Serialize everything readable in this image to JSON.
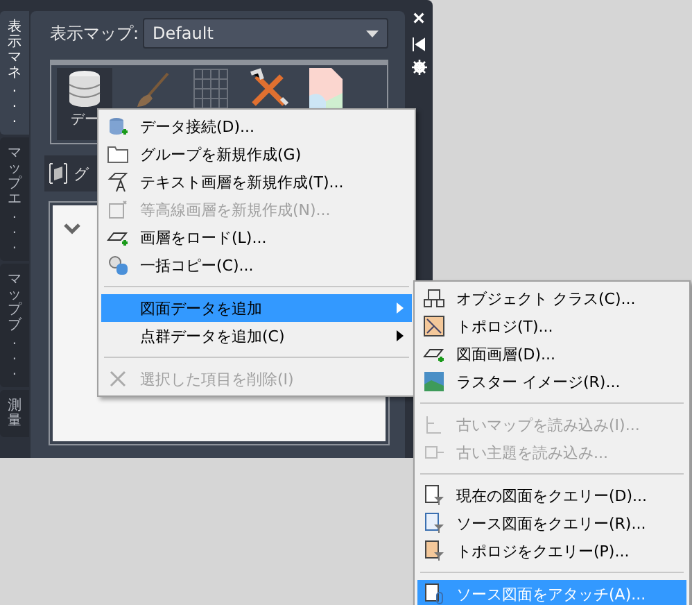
{
  "side_tabs": [
    {
      "label": "表示マネ...",
      "selected": true
    },
    {
      "label": "マップエ...",
      "selected": false
    },
    {
      "label": "マップブ...",
      "selected": false
    },
    {
      "label": "測量",
      "selected": false
    }
  ],
  "panel_controls": [
    "×"
  ],
  "map_selector": {
    "label": "表示マップ:",
    "value": "Default"
  },
  "toolbar": {
    "first_label": "デー"
  },
  "group_row": {
    "label": "グ"
  },
  "context_menu": [
    {
      "kind": "item",
      "label": "データ接続(D)...",
      "disabled": false,
      "selected": false
    },
    {
      "kind": "item",
      "label": "グループを新規作成(G)",
      "disabled": false,
      "selected": false
    },
    {
      "kind": "item",
      "label": "テキスト画層を新規作成(T)...",
      "disabled": false,
      "selected": false
    },
    {
      "kind": "item",
      "label": "等高線画層を新規作成(N)...",
      "disabled": true,
      "selected": false
    },
    {
      "kind": "item",
      "label": "画層をロード(L)...",
      "disabled": false,
      "selected": false
    },
    {
      "kind": "item",
      "label": "一括コピー(C)...",
      "disabled": false,
      "selected": false
    },
    {
      "kind": "separator"
    },
    {
      "kind": "submenu",
      "label": "図面データを追加",
      "disabled": false,
      "selected": true
    },
    {
      "kind": "submenu",
      "label": "点群データを追加(C)",
      "disabled": false,
      "selected": false
    },
    {
      "kind": "separator"
    },
    {
      "kind": "item",
      "label": "選択した項目を削除(I)",
      "disabled": true,
      "selected": false
    }
  ],
  "submenu": [
    {
      "kind": "item",
      "label": "オブジェクト クラス(C)...",
      "disabled": false,
      "selected": false
    },
    {
      "kind": "item",
      "label": "トポロジ(T)...",
      "disabled": false,
      "selected": false
    },
    {
      "kind": "item",
      "label": "図面画層(D)...",
      "disabled": false,
      "selected": false
    },
    {
      "kind": "item",
      "label": "ラスター イメージ(R)...",
      "disabled": false,
      "selected": false
    },
    {
      "kind": "separator"
    },
    {
      "kind": "item",
      "label": "古いマップを読み込み(I)...",
      "disabled": true,
      "selected": false
    },
    {
      "kind": "item",
      "label": "古い主題を読み込み...",
      "disabled": true,
      "selected": false
    },
    {
      "kind": "separator"
    },
    {
      "kind": "item",
      "label": "現在の図面をクエリー(D)...",
      "disabled": false,
      "selected": false
    },
    {
      "kind": "item",
      "label": "ソース図面をクエリー(R)...",
      "disabled": false,
      "selected": false
    },
    {
      "kind": "item",
      "label": "トポロジをクエリー(P)...",
      "disabled": false,
      "selected": false
    },
    {
      "kind": "separator"
    },
    {
      "kind": "item",
      "label": "ソース図面をアタッチ(A)...",
      "disabled": false,
      "selected": true
    }
  ]
}
